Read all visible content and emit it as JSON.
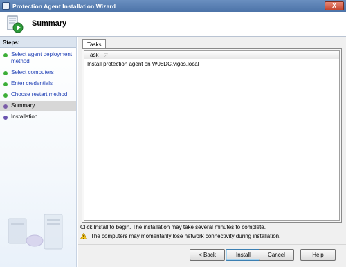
{
  "window": {
    "title": "Protection Agent Installation Wizard",
    "close_label": "X"
  },
  "header": {
    "title": "Summary",
    "icon": "wizard-play-icon"
  },
  "sidebar": {
    "steps_label": "Steps:",
    "items": [
      {
        "label": "Select agent deployment method",
        "state": "done"
      },
      {
        "label": "Select computers",
        "state": "done"
      },
      {
        "label": "Enter credentials",
        "state": "done"
      },
      {
        "label": "Choose restart method",
        "state": "done"
      },
      {
        "label": "Summary",
        "state": "current"
      },
      {
        "label": "Installation",
        "state": "pending"
      }
    ]
  },
  "main": {
    "tab_label": "Tasks",
    "list": {
      "column_header": "Task",
      "rows": [
        "Install protection agent on W08DC.vigos.local"
      ]
    },
    "info_text": "Click Install to begin. The installation may take several minutes to complete.",
    "warning_text": "The computers may momentarily lose network connectivity during installation."
  },
  "buttons": {
    "back": "< Back",
    "install": "Install",
    "cancel": "Cancel",
    "help": "Help"
  },
  "colors": {
    "titlebar": "#5a80b6",
    "step_done": "#3cae38",
    "step_pending": "#6a54b0",
    "link": "#1f3fb5"
  }
}
